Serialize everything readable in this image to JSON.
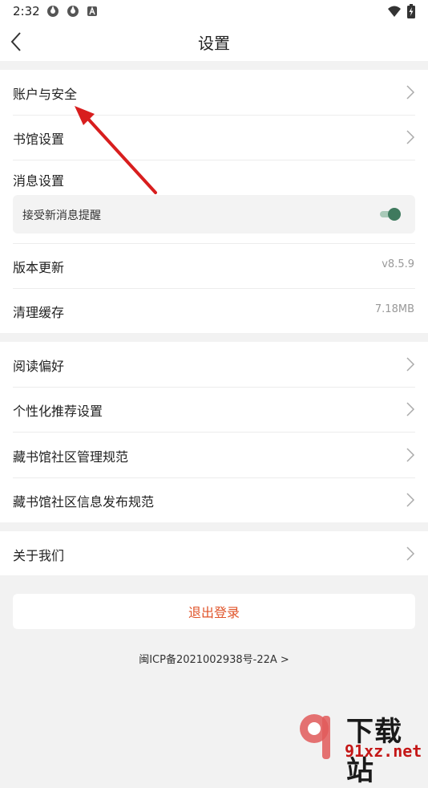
{
  "status_bar": {
    "time": "2:32",
    "icons": [
      "app-icon-1",
      "app-icon-2",
      "notification-a-icon",
      "wifi-icon",
      "battery-charging-icon"
    ]
  },
  "header": {
    "title": "设置"
  },
  "settings": {
    "account": {
      "label": "账户与安全"
    },
    "library": {
      "label": "书馆设置"
    },
    "message": {
      "label": "消息设置",
      "receive_label": "接受新消息提醒",
      "receive_enabled": true
    },
    "version": {
      "label": "版本更新",
      "value": "v8.5.9"
    },
    "cache": {
      "label": "清理缓存",
      "value": "7.18MB"
    },
    "reading": {
      "label": "阅读偏好"
    },
    "personal": {
      "label": "个性化推荐设置"
    },
    "community_mgmt": {
      "label": "藏书馆社区管理规范"
    },
    "community_publish": {
      "label": "藏书馆社区信息发布规范"
    },
    "about": {
      "label": "关于我们"
    }
  },
  "logout": {
    "label": "退出登录"
  },
  "icp": {
    "text": "闽ICP备2021002938号-22A >"
  },
  "watermark": {
    "big": "下载站",
    "small": "91xz.net"
  },
  "colors": {
    "accent_logout": "#e0542a",
    "toggle_on": "#3f7a5e",
    "annotation_arrow": "#d81e1e"
  }
}
